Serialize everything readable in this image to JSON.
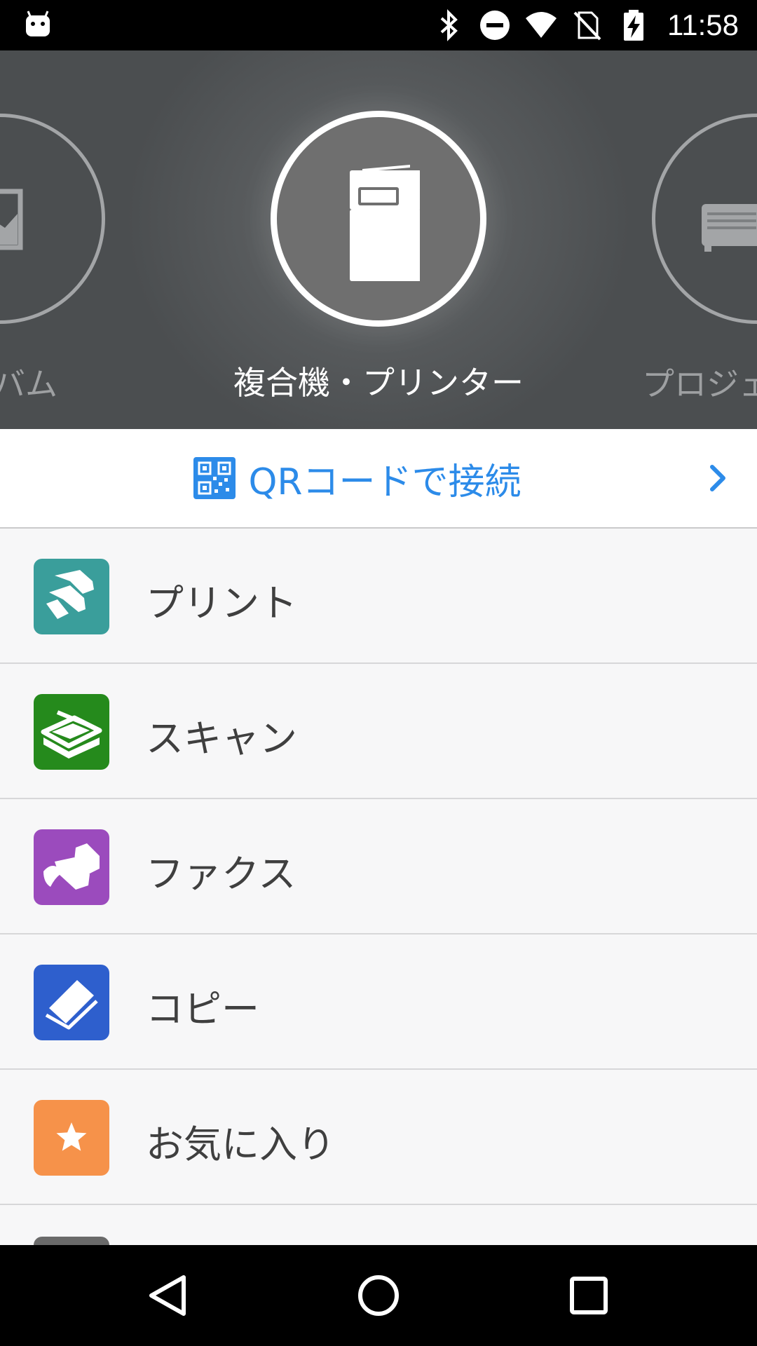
{
  "status_bar": {
    "time": "11:58",
    "icons": [
      "android-debug-icon",
      "bluetooth-icon",
      "do-not-disturb-icon",
      "wifi-icon",
      "no-sim-icon",
      "battery-charging-icon"
    ]
  },
  "carousel": {
    "left_label": "バム",
    "main_label": "複合機・プリンター",
    "right_label": "プロジェ",
    "main_icon": "printer-mfp-icon",
    "left_icon": "photo-album-icon",
    "right_icon": "projector-icon"
  },
  "qr_connect": {
    "label": "QRコードで接続",
    "icon": "qr-code-icon"
  },
  "menu": {
    "items": [
      {
        "label": "プリント",
        "icon": "print-icon",
        "color": "#3a9e9b"
      },
      {
        "label": "スキャン",
        "icon": "scan-icon",
        "color": "#258a1c"
      },
      {
        "label": "ファクス",
        "icon": "fax-icon",
        "color": "#9b4bbd"
      },
      {
        "label": "コピー",
        "icon": "copy-icon",
        "color": "#2e5fcd"
      },
      {
        "label": "お気に入り",
        "icon": "star-icon",
        "color": "#f6924a"
      }
    ]
  },
  "nav_bar": {
    "buttons": [
      "back-icon",
      "home-icon",
      "recents-icon"
    ]
  }
}
